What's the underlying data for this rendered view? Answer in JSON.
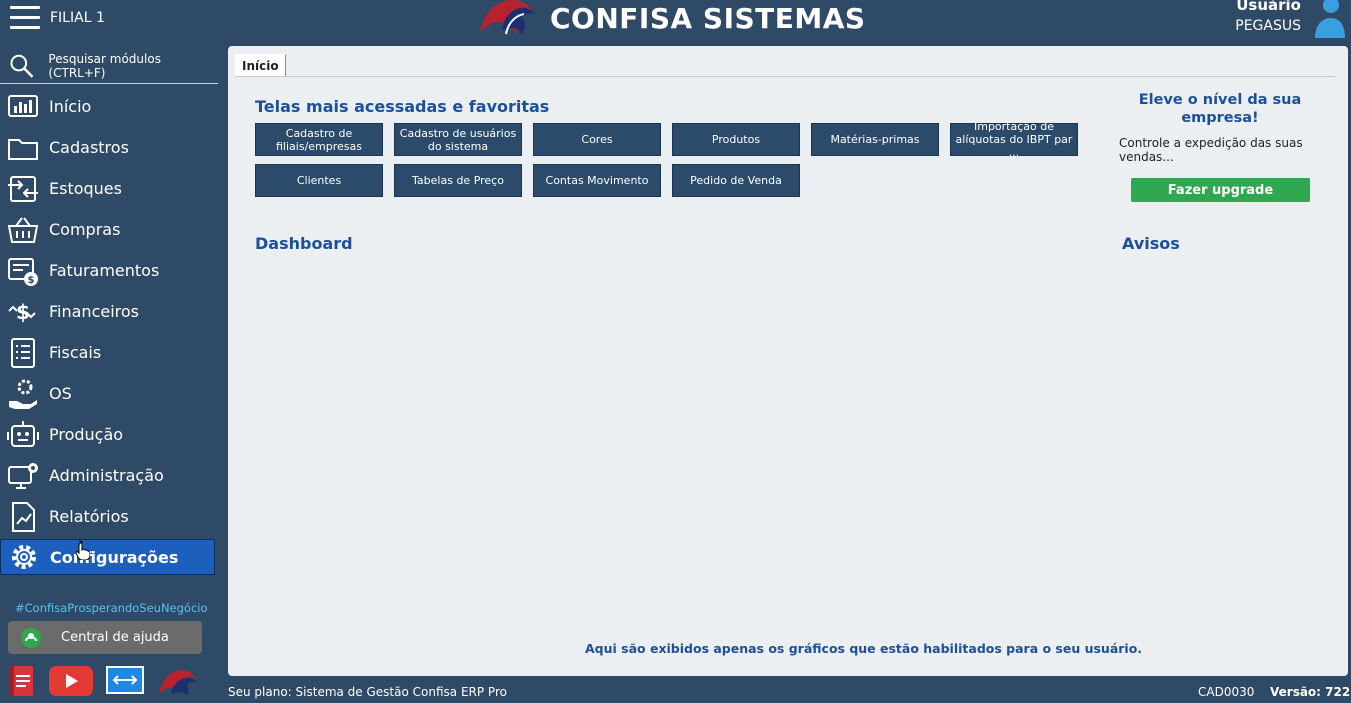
{
  "header": {
    "branch": "FILIAL 1",
    "logo_text": "CONFISA SISTEMAS",
    "user_title": "Usuário",
    "user_name": "PEGASUS"
  },
  "sidebar": {
    "search_placeholder": "Pesquisar módulos (CTRL+F)",
    "items": [
      {
        "label": "Início",
        "icon": "chart-monitor-icon"
      },
      {
        "label": "Cadastros",
        "icon": "folder-icon"
      },
      {
        "label": "Estoques",
        "icon": "stock-transfer-icon"
      },
      {
        "label": "Compras",
        "icon": "basket-icon"
      },
      {
        "label": "Faturamentos",
        "icon": "invoice-dollar-icon"
      },
      {
        "label": "Financeiros",
        "icon": "dollar-flow-icon"
      },
      {
        "label": "Fiscais",
        "icon": "checklist-icon"
      },
      {
        "label": "OS",
        "icon": "hand-gear-icon"
      },
      {
        "label": "Produção",
        "icon": "robot-icon"
      },
      {
        "label": "Administração",
        "icon": "monitor-gear-icon"
      },
      {
        "label": "Relatórios",
        "icon": "report-chart-icon"
      },
      {
        "label": "Configurações",
        "icon": "gear-icon",
        "active": true
      }
    ],
    "hashtag": "#ConfisaProsperandoSeuNegócio",
    "help_label": "Central de ajuda"
  },
  "main": {
    "tab_label": "Início",
    "favorites_title": "Telas mais acessadas e favoritas",
    "favorites": [
      "Cadastro de filiais/empresas",
      "Cadastro de usuários do sistema",
      "Cores",
      "Produtos",
      "Matérias-primas",
      "Importação de alíquotas do IBPT par ...",
      "Clientes",
      "Tabelas de Preço",
      "Contas Movimento",
      "Pedido de Venda"
    ],
    "dashboard_title": "Dashboard",
    "dashboard_note": "Aqui são exibidos apenas os gráficos que estão habilitados para o seu usuário.",
    "upgrade_title": "Eleve o nível da sua empresa!",
    "upgrade_text": "Controle a expedição das suas vendas...",
    "upgrade_button": "Fazer upgrade",
    "avisos_title": "Avisos"
  },
  "footer": {
    "plan": "Seu plano: Sistema de Gestão Confisa ERP Pro",
    "screen_code": "CAD0030",
    "version": "Versão: 722"
  },
  "colors": {
    "background": "#2e4a66",
    "panel": "#eceff1",
    "active_item": "#1d5fbd",
    "heading": "#1c4f9c",
    "upgrade": "#2fa84f",
    "hashtag": "#59c0f0"
  }
}
